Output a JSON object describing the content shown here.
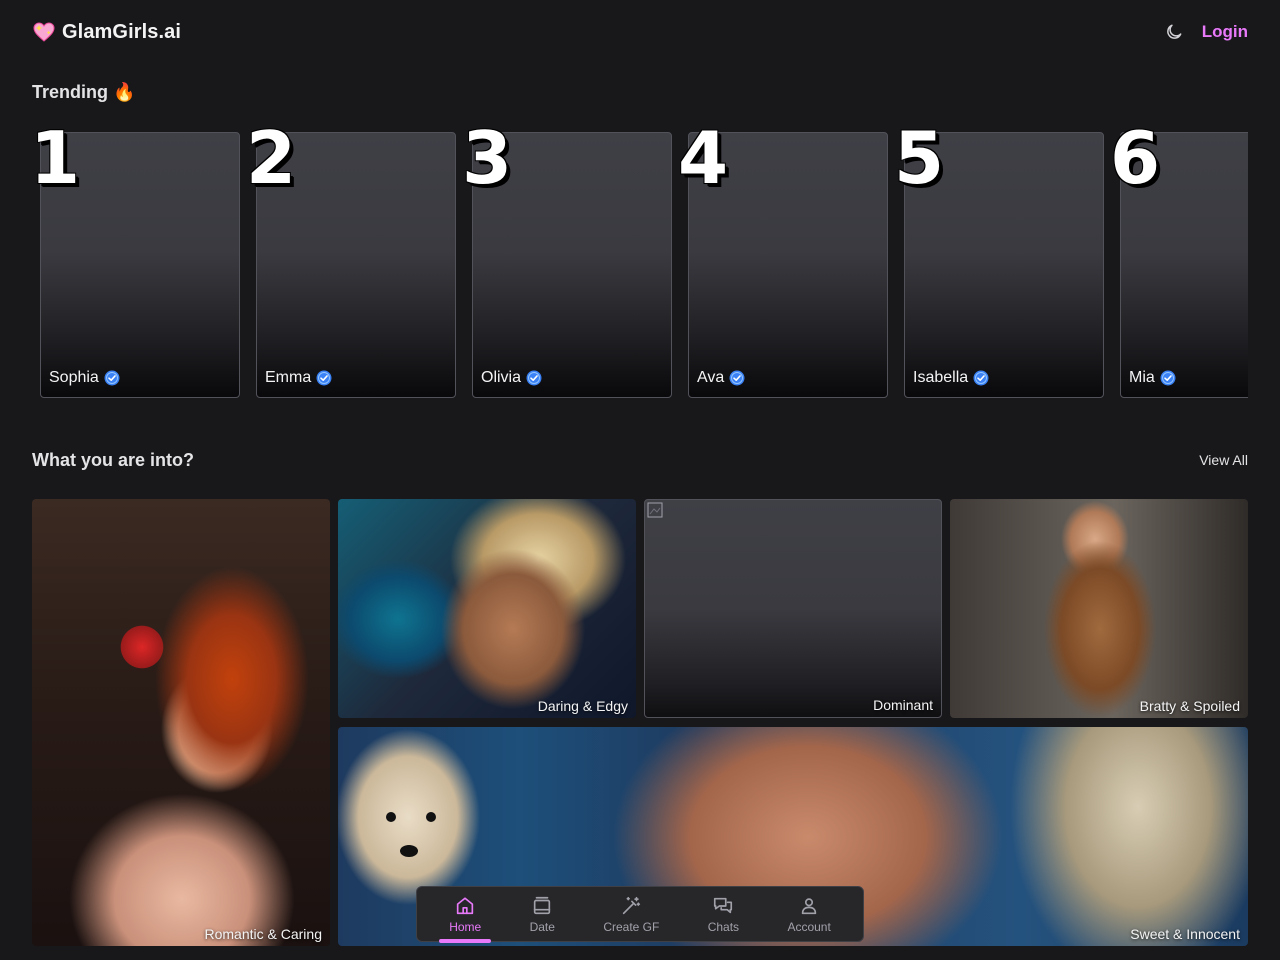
{
  "header": {
    "brand_name": "GlamGirls.ai",
    "login_label": "Login",
    "brand_heart_icon": "sparkling-heart-icon",
    "theme_icon": "moon-icon"
  },
  "colors": {
    "accent": "#e879f9",
    "background": "#18181b",
    "verified": "#3b82f6"
  },
  "trending": {
    "title": "Trending 🔥",
    "items": [
      {
        "rank": "1",
        "name": "Sophia"
      },
      {
        "rank": "2",
        "name": "Emma"
      },
      {
        "rank": "3",
        "name": "Olivia"
      },
      {
        "rank": "4",
        "name": "Ava"
      },
      {
        "rank": "5",
        "name": "Isabella"
      },
      {
        "rank": "6",
        "name": "Mia"
      }
    ]
  },
  "categories": {
    "title": "What you are into?",
    "view_all_label": "View All",
    "items": [
      {
        "label": "Romantic & Caring"
      },
      {
        "label": "Daring & Edgy"
      },
      {
        "label": "Dominant"
      },
      {
        "label": "Bratty & Spoiled"
      },
      {
        "label": "Sweet & Innocent"
      }
    ]
  },
  "bottom_nav": {
    "items": [
      {
        "label": "Home",
        "icon": "home-icon",
        "active": true
      },
      {
        "label": "Date",
        "icon": "cards-icon",
        "active": false
      },
      {
        "label": "Create GF",
        "icon": "magic-wand-icon",
        "active": false
      },
      {
        "label": "Chats",
        "icon": "chat-bubbles-icon",
        "active": false
      },
      {
        "label": "Account",
        "icon": "user-icon",
        "active": false
      }
    ]
  }
}
